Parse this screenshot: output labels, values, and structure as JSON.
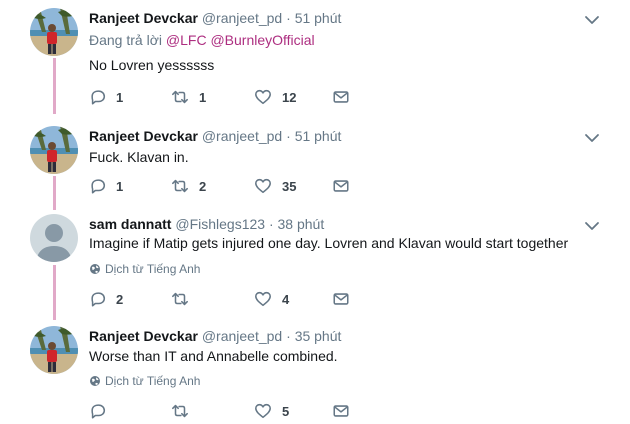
{
  "translate_label": "Dịch từ Tiếng Anh",
  "colors": {
    "accent": "#ad2e80",
    "thread_line": "#e1a9c8",
    "muted": "#657786"
  },
  "icons": {
    "reply": "reply-icon",
    "retweet": "retweet-icon",
    "like": "heart-icon",
    "message": "envelope-icon",
    "menu": "chevron-down-icon",
    "translate": "globe-icon"
  },
  "tweets": [
    {
      "name": "Ranjeet Devckar",
      "handle": "@ranjeet_pd",
      "sep": "·",
      "time": "51 phút",
      "reply_prefix": "Đang trả lời ",
      "reply_mentions": [
        "@LFC",
        "@BurnleyOfficial"
      ],
      "text": "No Lovren yessssss",
      "replies": "1",
      "retweets": "1",
      "likes": "12"
    },
    {
      "name": "Ranjeet Devckar",
      "handle": "@ranjeet_pd",
      "sep": "·",
      "time": "51 phút",
      "text": "Fuck. Klavan in.",
      "replies": "1",
      "retweets": "2",
      "likes": "35"
    },
    {
      "name": "sam dannatt",
      "handle": "@Fishlegs123",
      "sep": "·",
      "time": "38 phút",
      "text": "Imagine if Matip gets injured one day. Lovren and Klavan would start together",
      "replies": "2",
      "retweets": "",
      "likes": "4"
    },
    {
      "name": "Ranjeet Devckar",
      "handle": "@ranjeet_pd",
      "sep": "·",
      "time": "35 phút",
      "text": "Worse than IT and Annabelle combined.",
      "replies": "",
      "retweets": "",
      "likes": "5"
    }
  ]
}
